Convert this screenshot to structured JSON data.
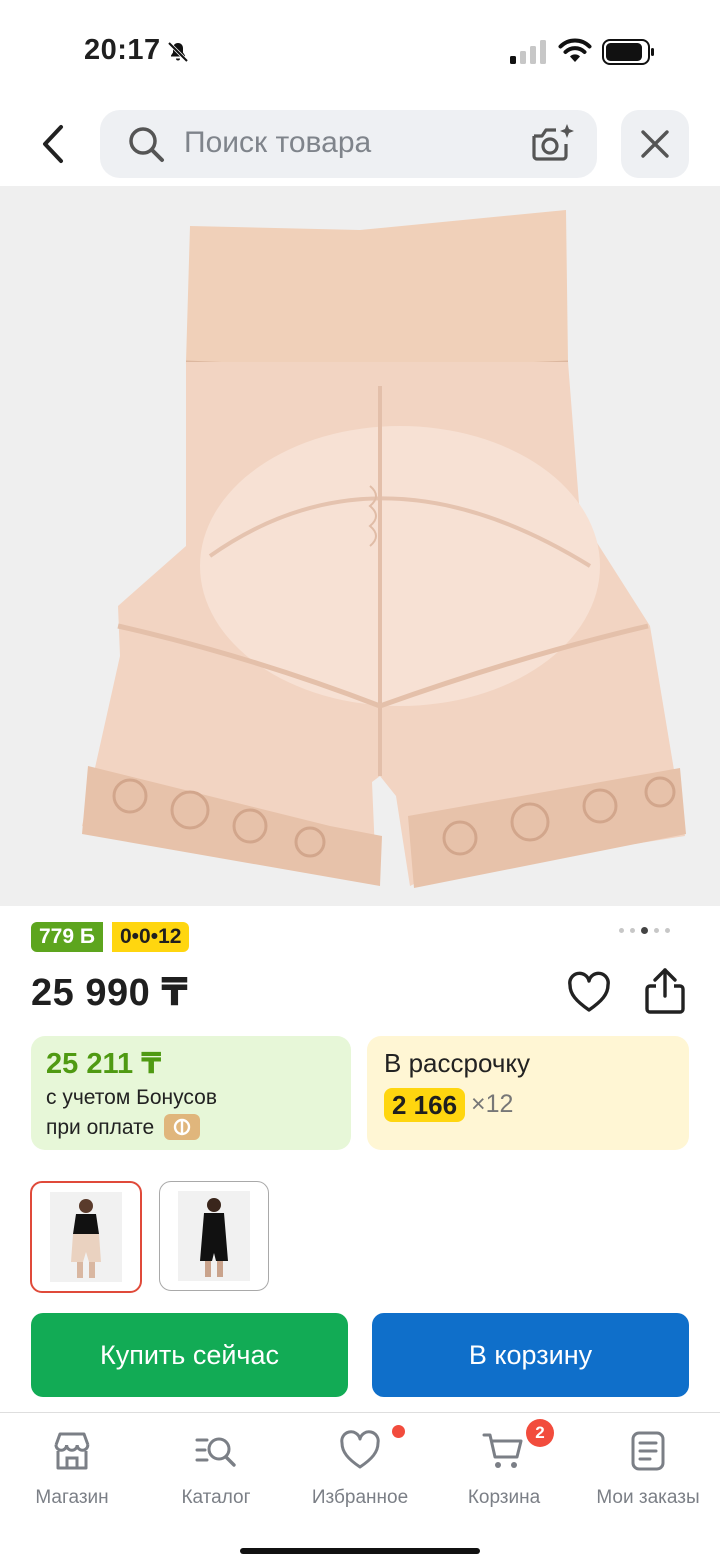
{
  "status_bar": {
    "time": "20:17",
    "icons": [
      "bell-slash-icon",
      "signal-icon",
      "wifi-icon",
      "battery-icon"
    ]
  },
  "header": {
    "back_icon": "chevron-left-icon",
    "search_placeholder": "Поиск товара",
    "search_icon": "magnifier-icon",
    "camera_icon": "camera-sparkle-icon",
    "close_icon": "close-icon"
  },
  "gallery": {
    "image": "beige shapewear shorts, back view",
    "page_count": 4,
    "active_page": 3
  },
  "badges": {
    "bonus": "779 Б",
    "installment": "0•0•12"
  },
  "price": "25 990 ₸",
  "bonus_card": {
    "price": "25 211 ₸",
    "line1": "с учетом Бонусов",
    "line2": "при оплате"
  },
  "installment_card": {
    "title": "В рассрочку",
    "amount": "2 166",
    "times": "×12"
  },
  "variants": [
    {
      "name": "black-top-beige-shorts",
      "selected": true
    },
    {
      "name": "black-bodysuit",
      "selected": false
    }
  ],
  "actions": {
    "buy_now": "Купить сейчас",
    "add_to_cart": "В корзину"
  },
  "tabbar": {
    "items": [
      {
        "label": "Магазин",
        "icon": "store-icon"
      },
      {
        "label": "Каталог",
        "icon": "catalog-search-icon"
      },
      {
        "label": "Избранное",
        "icon": "heart-icon"
      },
      {
        "label": "Корзина",
        "icon": "cart-icon",
        "badge": "2"
      },
      {
        "label": "Мои заказы",
        "icon": "orders-icon"
      }
    ]
  },
  "colors": {
    "green": "#12ab55",
    "blue": "#0f6fca",
    "bonus_green": "#5da51e",
    "yellow": "#ffd60f",
    "red": "#f24c3d"
  }
}
